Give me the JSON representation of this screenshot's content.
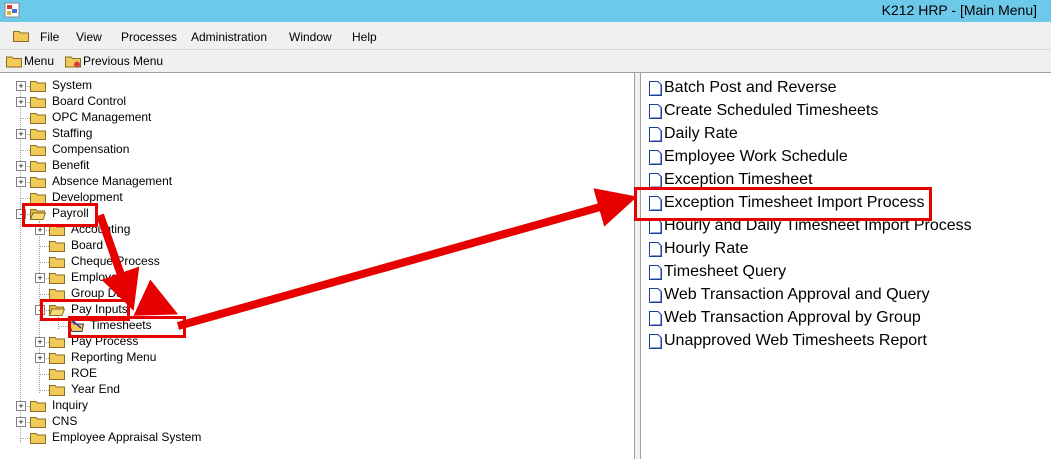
{
  "window": {
    "title": "K212 HRP - [Main Menu]"
  },
  "menubar": {
    "items": [
      "File",
      "View",
      "Processes",
      "Administration",
      "Window",
      "Help"
    ]
  },
  "toolbar": {
    "menu_label": "Menu",
    "previous_label": "Previous Menu"
  },
  "tree": {
    "items": [
      {
        "label": "System",
        "expander": "+"
      },
      {
        "label": "Board Control",
        "expander": "+"
      },
      {
        "label": "OPC Management",
        "expander": ""
      },
      {
        "label": "Staffing",
        "expander": "+"
      },
      {
        "label": "Compensation",
        "expander": ""
      },
      {
        "label": "Benefit",
        "expander": "+"
      },
      {
        "label": "Absence Management",
        "expander": "+"
      },
      {
        "label": "Development",
        "expander": ""
      },
      {
        "label": "Payroll",
        "expander": "-"
      },
      {
        "label": "Accounting",
        "expander": "+"
      },
      {
        "label": "Board",
        "expander": ""
      },
      {
        "label": "Cheque Process",
        "expander": ""
      },
      {
        "label": "Employee",
        "expander": "+"
      },
      {
        "label": "Group Data",
        "expander": ""
      },
      {
        "label": "Pay Inputs",
        "expander": "-"
      },
      {
        "label": "Timesheets",
        "expander": ""
      },
      {
        "label": "Pay Process",
        "expander": "+"
      },
      {
        "label": "Reporting Menu",
        "expander": "+"
      },
      {
        "label": "ROE",
        "expander": ""
      },
      {
        "label": "Year End",
        "expander": ""
      },
      {
        "label": "Inquiry",
        "expander": "+"
      },
      {
        "label": "CNS",
        "expander": "+"
      },
      {
        "label": "Employee Appraisal System",
        "expander": ""
      }
    ]
  },
  "right_list": {
    "items": [
      "Batch Post and Reverse",
      "Create Scheduled Timesheets",
      "Daily Rate",
      "Employee Work Schedule",
      "Exception Timesheet",
      "Exception Timesheet Import Process",
      "Hourly and Daily Timesheet Import Process",
      "Hourly Rate",
      "Timesheet Query",
      "Web Transaction Approval and Query",
      "Web Transaction Approval by Group",
      "Unapproved Web Timesheets Report"
    ]
  },
  "colors": {
    "titlebar": "#6dc9ea",
    "highlight": "#e60000",
    "folder": "#f3c95a"
  },
  "icons": {
    "app": "app-logo-icon",
    "folder": "folder-icon",
    "open_folder": "open-folder-icon",
    "document": "document-icon",
    "previous_menu": "previous-menu-icon"
  }
}
